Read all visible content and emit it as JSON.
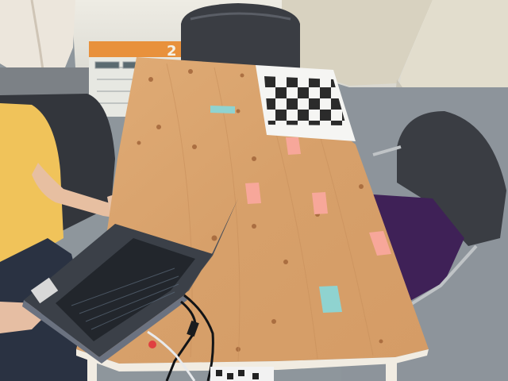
{
  "scene": {
    "calendar": {
      "year_fragment": "2"
    },
    "colors": {
      "table_wood": "#d9a46e",
      "table_edge": "#f1ece2",
      "floor": "#8e969c",
      "wall": "#e9e7df",
      "chair": "#3a3d43",
      "seat_cushion": "#3f2157",
      "shirt": "#f0c35a",
      "laptop_body": "#3b4048",
      "keyboard": "#22262c",
      "sticky_pink": "#f7a79a",
      "sticky_cyan": "#8fd3d0",
      "checker_dark": "#2b2b2b",
      "checker_paper": "#f5f5f3"
    }
  }
}
